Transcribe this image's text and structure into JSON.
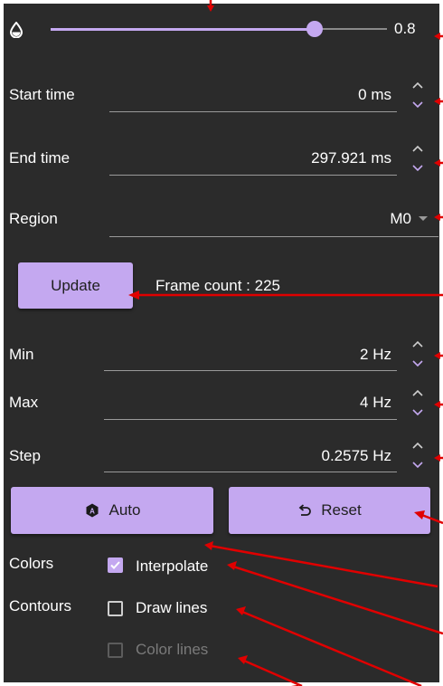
{
  "opacity": {
    "icon": "droplet-icon",
    "value": 0.8,
    "value_label": "0.8"
  },
  "start_time": {
    "label": "Start time",
    "value": "0",
    "unit": "ms"
  },
  "end_time": {
    "label": "End time",
    "value": "297.921",
    "unit": "ms"
  },
  "region": {
    "label": "Region",
    "value": "M0"
  },
  "update": {
    "label": "Update",
    "frame_count_label": "Frame count :",
    "frame_count": "225"
  },
  "min": {
    "label": "Min",
    "value": "2",
    "unit": "Hz"
  },
  "max": {
    "label": "Max",
    "value": "4",
    "unit": "Hz"
  },
  "step": {
    "label": "Step",
    "value": "0.2575",
    "unit": "Hz"
  },
  "auto_button": {
    "label": "Auto",
    "icon": "auto-gear-icon"
  },
  "reset_button": {
    "label": "Reset",
    "icon": "undo-icon"
  },
  "colors": {
    "label": "Colors",
    "interpolate_label": "Interpolate",
    "interpolate_checked": true
  },
  "contours": {
    "label": "Contours",
    "draw_lines_label": "Draw lines",
    "draw_lines_checked": false,
    "color_lines_label": "Color lines",
    "color_lines_checked": false,
    "color_lines_disabled": true
  },
  "colors_palette": {
    "accent": "#c4a8f0",
    "background": "#2b2b2b",
    "annotation": "#e00000"
  }
}
